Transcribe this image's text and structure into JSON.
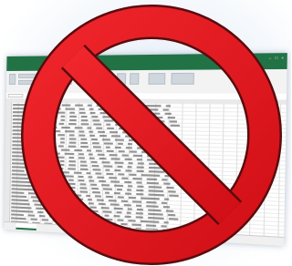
{
  "image": {
    "subject": "no-sign-over-spreadsheet",
    "colors": {
      "prohibition_red": "#e3151c",
      "prohibition_outline": "#5a0b0e",
      "spreadsheet_green": "#217346",
      "background_tint": "#e3ecf7"
    }
  },
  "icons": {
    "overlay": "no-entry-prohibition-icon",
    "background": "spreadsheet-window"
  }
}
